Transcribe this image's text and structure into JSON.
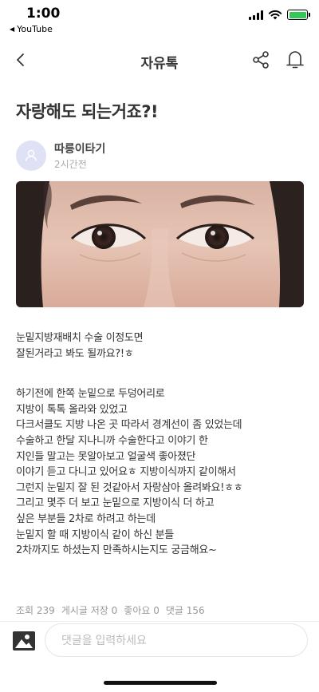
{
  "status_bar": {
    "time": "1:00",
    "back_app": "YouTube",
    "battery_color": "#35c759"
  },
  "header": {
    "title": "자유톡",
    "back_icon": "chevron-left-icon",
    "share_icon": "share-icon",
    "bell_icon": "bell-icon"
  },
  "post": {
    "title": "자랑해도 되는거죠?!",
    "author": "따릉이타기",
    "posted": "2시간전",
    "image_alt": "eyes-photo",
    "paragraphs": [
      [
        "눈밑지방재배치 수술 이정도면",
        "잘된거라고 봐도 될까요?!ㅎ"
      ],
      [
        "하기전에 한쪽 눈밑으로 두덩어리로",
        "지방이 톡톡 올라와 있었고",
        "다크서클도 지방 나온 곳 따라서 경계선이 좀 있었는데",
        "수술하고 한달 지나니까 수술한다고 이야기 한",
        "지인들 말고는 못알아보고 얼굴색 좋아졌단",
        "이야기 듣고 다니고 있어요ㅎ 지방이식까지 같이해서",
        "그런지 눈밑지 잘 된 것같아서 자랑삼아 올려봐요!ㅎㅎ",
        "그리고 몇주 더 보고 눈밑으로 지방이식 더 하고",
        "싶은 부분들 2차로 하려고 하는데",
        "눈밑지 할 때 지방이식 같이 하신 분들",
        "2차까지도 하셨는지 만족하시는지도 궁금해요~"
      ]
    ]
  },
  "stats": {
    "views": "조회 239",
    "saves": "게시글 저장 0",
    "likes": "좋아요 0",
    "comments": "댓글 156"
  },
  "comment_bar": {
    "placeholder": "댓글을 입력하세요",
    "image_icon": "image-icon"
  }
}
